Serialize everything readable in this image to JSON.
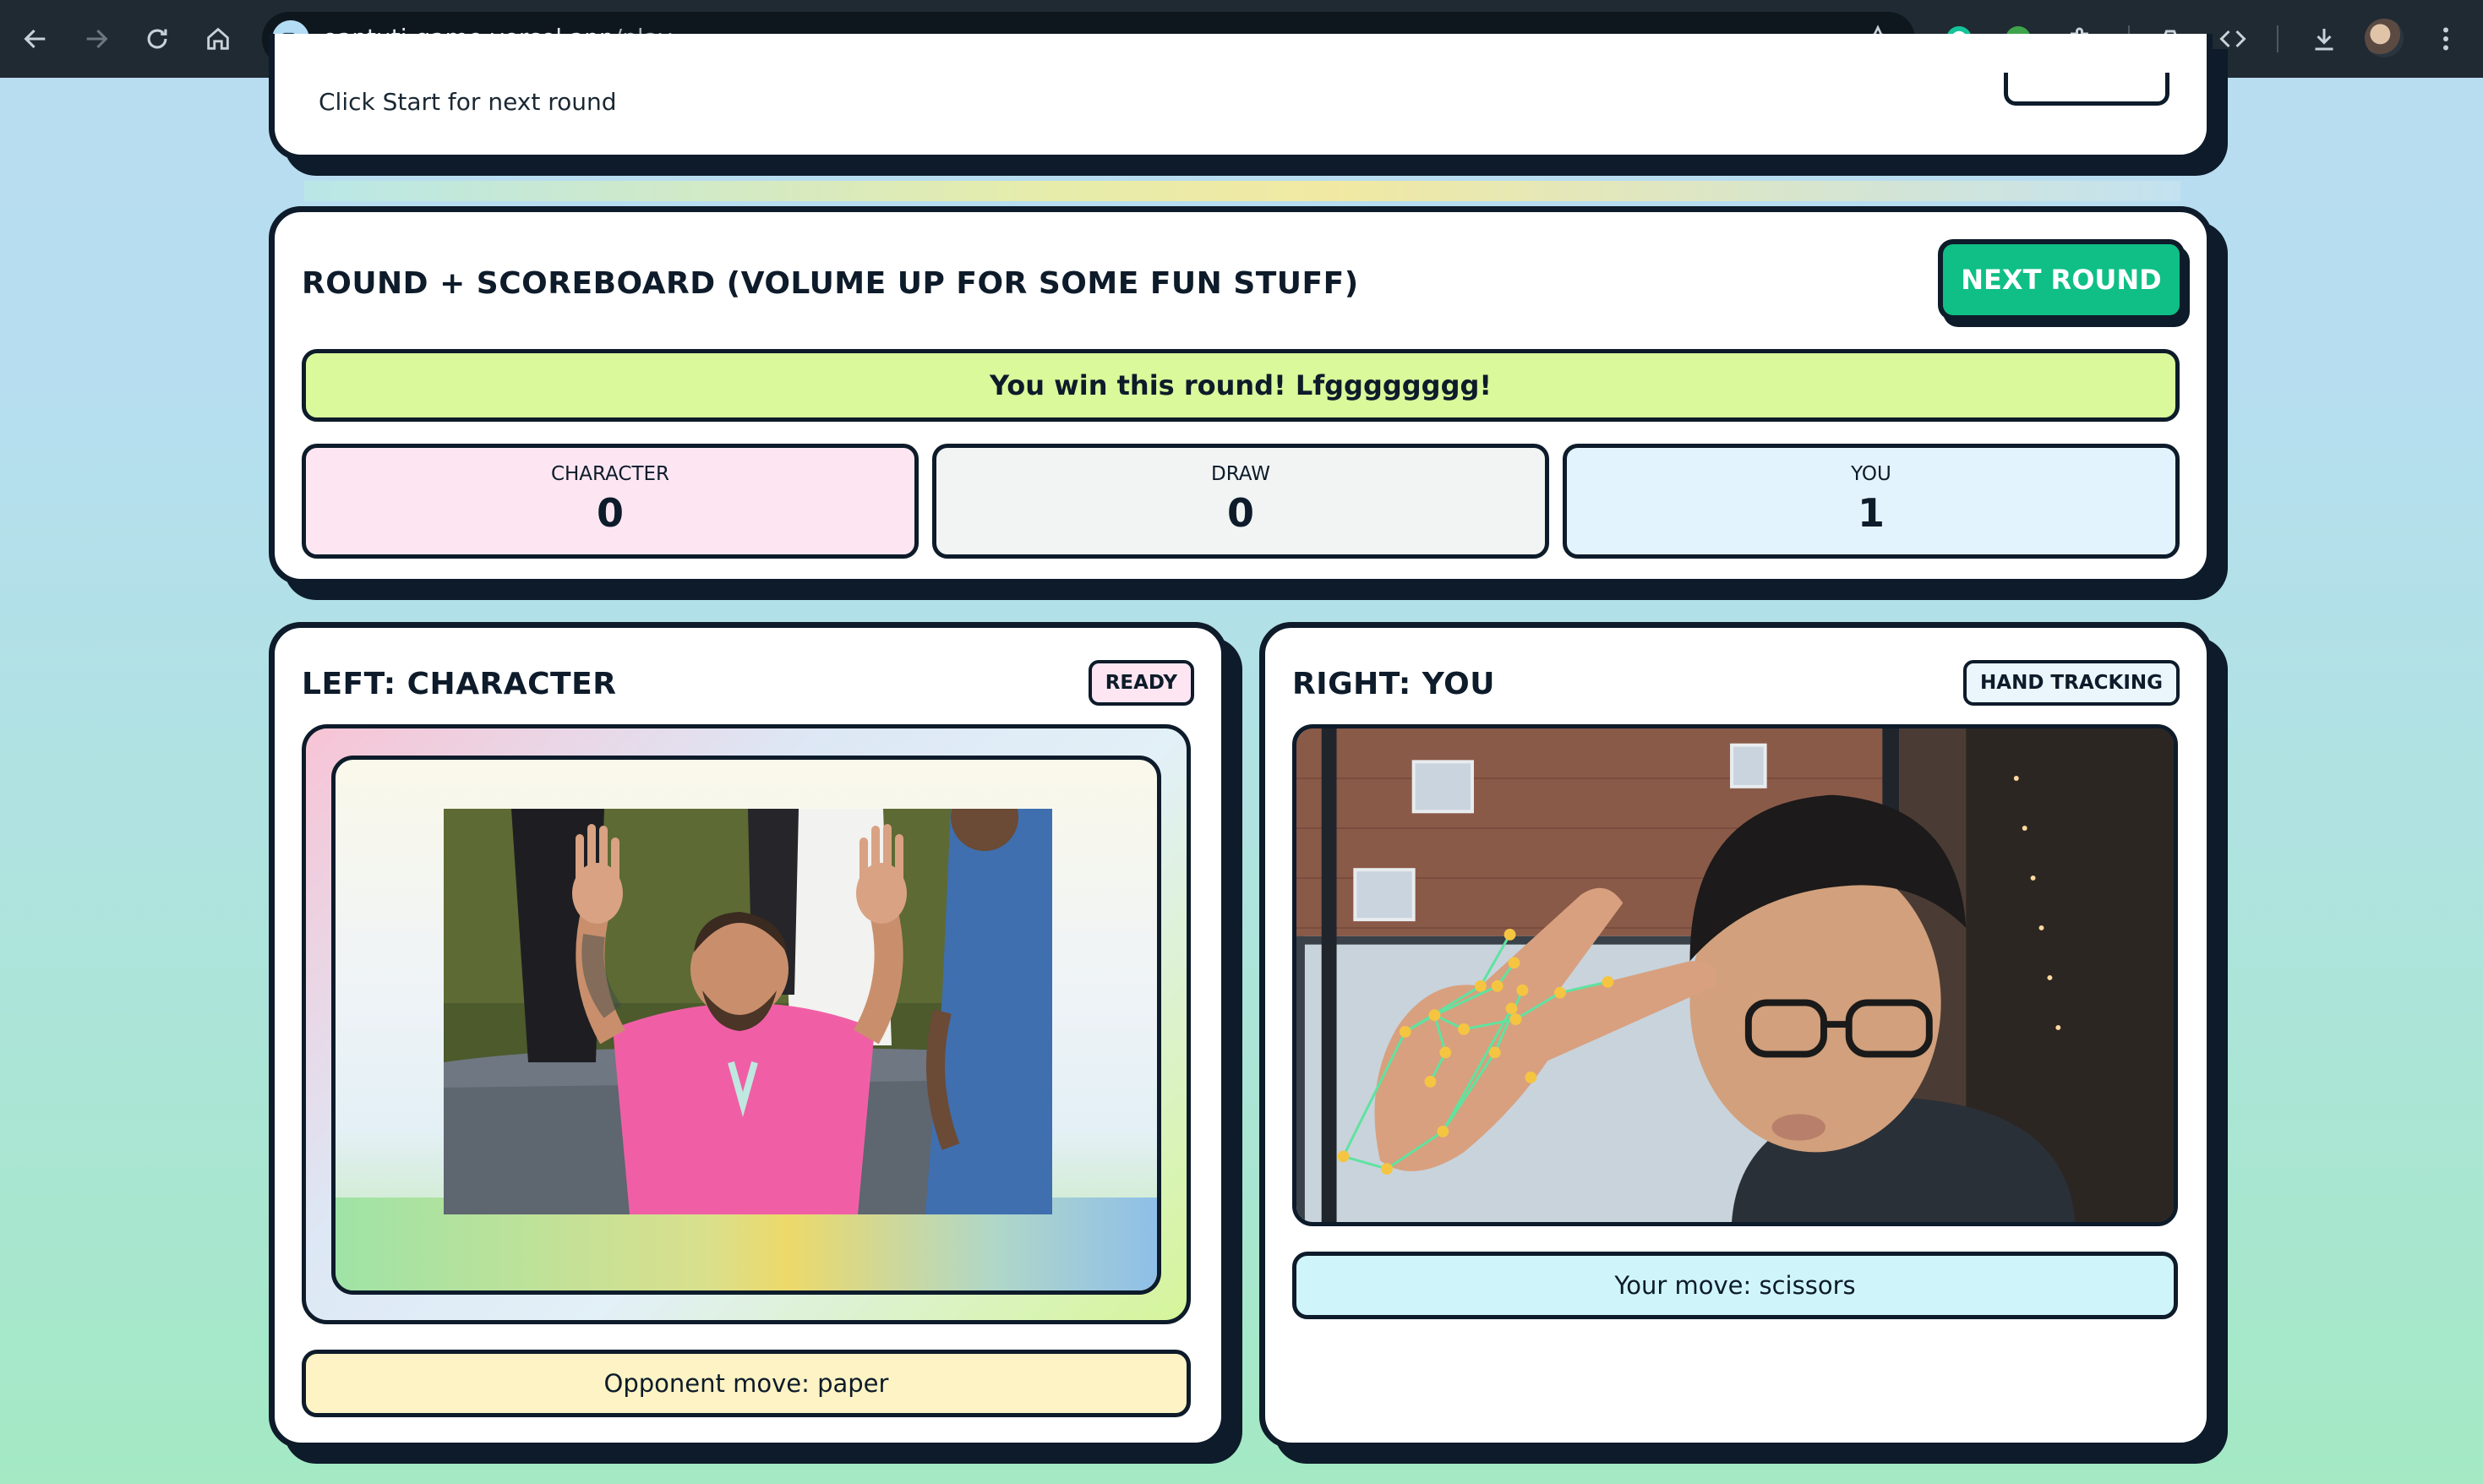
{
  "browser": {
    "url_host": "oantuti-game.vercel.app",
    "url_path": "/play"
  },
  "top_card": {
    "hint": "Click Start for next round"
  },
  "scoreboard": {
    "title": "ROUND + SCOREBOARD (VOLUME UP FOR SOME FUN STUFF)",
    "next_round_label": "NEXT ROUND",
    "result_text": "You win this round! Lfgggggggg!",
    "boxes": [
      {
        "label": "CHARACTER",
        "value": "0",
        "color": "#fde6f2"
      },
      {
        "label": "DRAW",
        "value": "0",
        "color": "#f2f4f4"
      },
      {
        "label": "YOU",
        "value": "1",
        "color": "#e3f3fd"
      }
    ]
  },
  "left_panel": {
    "title": "LEFT: CHARACTER",
    "status": "READY",
    "opponent_move": "Opponent move: paper"
  },
  "right_panel": {
    "title": "RIGHT: YOU",
    "status": "HAND TRACKING",
    "your_move": "Your move: scissors"
  },
  "colors": {
    "accent_green": "#0fbf85",
    "result_banner": "#d9f99b",
    "ready_pill": "#fde6f2",
    "tracking_pill": "#eaf5fc",
    "opponent_move_bg": "#fdf3c4",
    "your_move_bg": "#cff5fb",
    "outline": "#0d1b2a"
  }
}
